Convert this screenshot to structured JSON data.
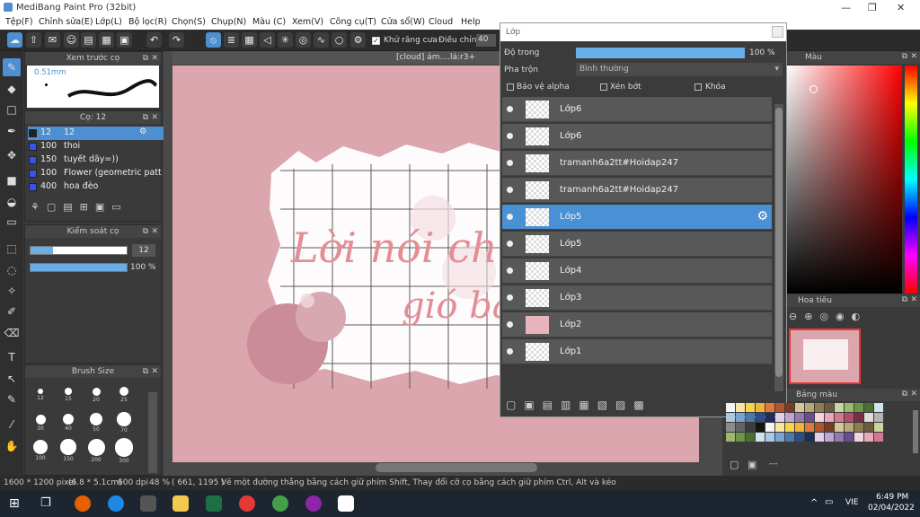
{
  "app": {
    "title": "MediBang Paint Pro (32bit)"
  },
  "menu": [
    "Tệp(F)",
    "Chỉnh sửa(E)",
    "Lớp(L)",
    "Bộ lọc(R)",
    "Chọn(S)",
    "Chụp(N)",
    "Màu (C)",
    "Xem(V)",
    "Công cụ(T)",
    "Cửa sổ(W)",
    "Cloud",
    "Help"
  ],
  "toolbar": {
    "antialias_label": "Khử răng cưa",
    "correction_label": "Điều chỉnh",
    "correction_value": "40"
  },
  "canvas": {
    "tab_title": "[cloud] ảm....lá:r3+"
  },
  "preview_panel": {
    "title": "Xem trước cọ",
    "size": "0.51mm"
  },
  "brush_panel": {
    "title": "Cọ: 12",
    "items": [
      {
        "size": "12",
        "name": "12"
      },
      {
        "size": "100",
        "name": "thoi"
      },
      {
        "size": "150",
        "name": "tuyết dãy=))"
      },
      {
        "size": "100",
        "name": "Flower (geometric patt"
      },
      {
        "size": "400",
        "name": "hoa đèo"
      }
    ]
  },
  "control_panel": {
    "title": "Kiểm soát cọ",
    "size_value": "12",
    "opacity_value": "100 %"
  },
  "brush_size_panel": {
    "title": "Brush Size",
    "sizes": [
      "12",
      "15",
      "20",
      "25",
      "30",
      "40",
      "50",
      "70",
      "100",
      "150",
      "200",
      "300"
    ]
  },
  "layer_window": {
    "title": "Lớp",
    "opacity_label": "Độ trong",
    "opacity_value": "100 %",
    "blend_label": "Pha trộn",
    "blend_value": "Bình thường",
    "protect_alpha": "Bảo vệ alpha",
    "clipping": "Xén bớt",
    "lock": "Khóa",
    "layers": [
      {
        "name": "Lớp6"
      },
      {
        "name": "Lớp6"
      },
      {
        "name": "tramanh6a2tt#Hoidap247"
      },
      {
        "name": "tramanh6a2tt#Hoidap247"
      },
      {
        "name": "Lớp5"
      },
      {
        "name": "Lớp5"
      },
      {
        "name": "Lớp4"
      },
      {
        "name": "Lớp3"
      },
      {
        "name": "Lớp2"
      },
      {
        "name": "Lớp1"
      }
    ]
  },
  "color_panel": {
    "title": "Màu"
  },
  "navigator_panel": {
    "title": "Hoa tiêu"
  },
  "palette_panel": {
    "title": "Bảng màu",
    "footer": "---"
  },
  "artwork": {
    "text_line1": "Lời nói chỉ",
    "text_line2": "gió ba"
  },
  "status": {
    "dimensions": "1600 * 1200 pixel",
    "physical": "(6.8 * 5.1cm)",
    "dpi": "600 dpi",
    "zoom": "48 %",
    "coords": "( 661, 1195 )",
    "hint": "Vẽ một đường thẳng bằng cách giữ phím Shift, Thay đổi cỡ cọ bằng cách giữ phím Ctrl, Alt và kéo"
  },
  "taskbar": {
    "lang": "VIE",
    "time": "6:49 PM",
    "date": "02/04/2022"
  },
  "colors": {
    "accent": "#4d8fd1",
    "canvas_pink": "#dba6ae",
    "text_pink": "#e48d95"
  }
}
